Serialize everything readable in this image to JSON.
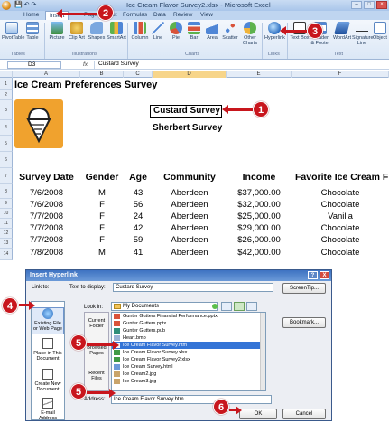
{
  "excel": {
    "window_title": "Ice Cream Flavor Survey2.xlsx - Microsoft Excel",
    "tabs": [
      "Home",
      "Insert",
      "Page Layout",
      "Formulas",
      "Data",
      "Review",
      "View"
    ],
    "active_tab": "Insert",
    "ribbon_buttons": [
      {
        "label": "PivotTable",
        "icon": "pivottable-icon"
      },
      {
        "label": "Table",
        "icon": "table-icon"
      },
      {
        "label": "Picture",
        "icon": "picture-icon"
      },
      {
        "label": "Clip Art",
        "icon": "clipart-icon"
      },
      {
        "label": "Shapes",
        "icon": "shapes-icon"
      },
      {
        "label": "SmartArt",
        "icon": "smartart-icon"
      },
      {
        "label": "Column",
        "icon": "column-chart-icon"
      },
      {
        "label": "Line",
        "icon": "line-chart-icon"
      },
      {
        "label": "Pie",
        "icon": "pie-chart-icon"
      },
      {
        "label": "Bar",
        "icon": "bar-chart-icon"
      },
      {
        "label": "Area",
        "icon": "area-chart-icon"
      },
      {
        "label": "Scatter",
        "icon": "scatter-chart-icon"
      },
      {
        "label": "Other Charts",
        "icon": "other-charts-icon"
      },
      {
        "label": "Hyperlink",
        "icon": "hyperlink-icon"
      },
      {
        "label": "Text Box",
        "icon": "textbox-icon"
      },
      {
        "label": "Header & Footer",
        "icon": "header-footer-icon"
      },
      {
        "label": "WordArt",
        "icon": "wordart-icon"
      },
      {
        "label": "Signature Line",
        "icon": "signature-icon"
      },
      {
        "label": "Object",
        "icon": "object-icon"
      }
    ],
    "groups": [
      "Tables",
      "Illustrations",
      "Charts",
      "Links",
      "Text"
    ],
    "name_box": "D3",
    "formula_fx": "fx",
    "formula_value": "Custard Survey",
    "columns": [
      "A",
      "B",
      "C",
      "D",
      "E",
      "F"
    ],
    "selected_column": "D",
    "row_numbers": [
      "1",
      "2",
      "3",
      "4",
      "5",
      "6",
      "7",
      "8",
      "9",
      "10",
      "11",
      "12",
      "13",
      "14"
    ],
    "sheet_title": "Ice Cream Preferences Survey",
    "link_cell_1": "Custard Survey",
    "link_cell_2": "Sherbert Survey",
    "headers": [
      "Survey Date",
      "Gender",
      "Age",
      "Community",
      "Income",
      "Favorite Ice Cream F"
    ],
    "rows": [
      [
        "7/6/2008",
        "M",
        "43",
        "Aberdeen",
        "$37,000.00",
        "Chocolate"
      ],
      [
        "7/6/2008",
        "F",
        "56",
        "Aberdeen",
        "$32,000.00",
        "Chocolate"
      ],
      [
        "7/7/2008",
        "F",
        "24",
        "Aberdeen",
        "$25,000.00",
        "Vanilla"
      ],
      [
        "7/7/2008",
        "F",
        "42",
        "Aberdeen",
        "$29,000.00",
        "Chocolate"
      ],
      [
        "7/7/2008",
        "F",
        "59",
        "Aberdeen",
        "$26,000.00",
        "Chocolate"
      ],
      [
        "7/8/2008",
        "M",
        "41",
        "Aberdeen",
        "$42,000.00",
        "Chocolate"
      ]
    ]
  },
  "dialog": {
    "title": "Insert Hyperlink",
    "help_label": "?",
    "close_label": "X",
    "link_to_label": "Link to:",
    "text_to_display_label": "Text to display:",
    "text_to_display_value": "Custard Survey",
    "screentip_label": "ScreenTip...",
    "look_in_label": "Look in:",
    "look_in_value": "My Documents",
    "bookmark_label": "Bookmark...",
    "link_types": [
      "Existing File or Web Page",
      "Place in This Document",
      "Create New Document",
      "E-mail Address"
    ],
    "places": [
      "Current Folder",
      "Browsed Pages",
      "Recent Files"
    ],
    "files": [
      "Gunter Gutters Financial Performance.pptx",
      "Gunter Gutters.pptx",
      "Gunter Gutters.pub",
      "Heart.bmp",
      "Ice Cream Flavor Survey.htm",
      "Ice Cream Flavor Survey.xlsx",
      "Ice Cream Flavor Survey2.xlsx",
      "Ice Cream Survey.html",
      "Ice Cream2.jpg",
      "Ice Cream3.jpg"
    ],
    "selected_file_index": 4,
    "address_label": "Address:",
    "address_value": "Ice Cream Flavor Survey.htm",
    "ok_label": "OK",
    "cancel_label": "Cancel"
  },
  "callouts": [
    "1",
    "2",
    "3",
    "4",
    "5",
    "5",
    "6"
  ],
  "colors": {
    "callout": "#c8161d",
    "ribbon": "#dbe7f6",
    "selection": "#3474d6",
    "icecream_bg": "#f0a22e"
  }
}
